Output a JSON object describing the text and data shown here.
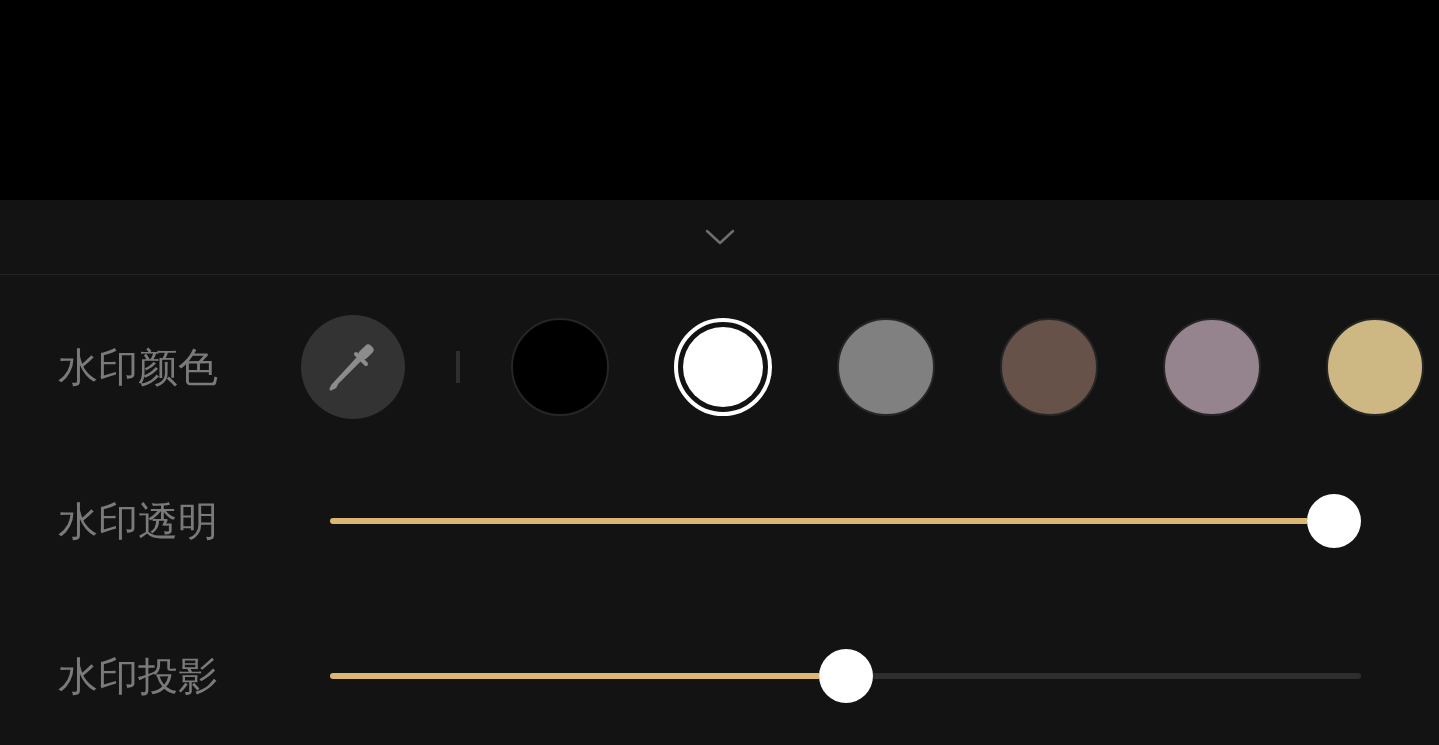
{
  "color_row": {
    "label": "水印颜色",
    "swatches": [
      {
        "color": "#000000",
        "selected": false
      },
      {
        "color": "#ffffff",
        "selected": true
      },
      {
        "color": "#808080",
        "selected": false
      },
      {
        "color": "#67524a",
        "selected": false
      },
      {
        "color": "#95838e",
        "selected": false
      },
      {
        "color": "#cdb783",
        "selected": false
      }
    ]
  },
  "sliders": [
    {
      "label": "水印透明",
      "level": 1
    },
    {
      "label": "水印投影",
      "level": 0.5
    }
  ]
}
